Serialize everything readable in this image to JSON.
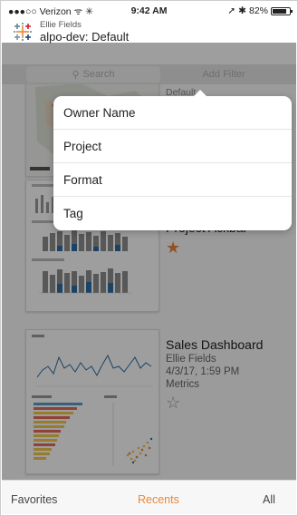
{
  "status_bar": {
    "carrier": "●●●○○ Verizon ᯤ ✳",
    "time": "9:42 AM",
    "location_glyph": "➚",
    "bluetooth_glyph": "✱",
    "battery": "82%"
  },
  "header": {
    "user": "Ellie Fields",
    "site": "alpo-dev: Default"
  },
  "search": {
    "placeholder_icon": "⚲",
    "placeholder": "Search",
    "filter_label": "Add Filter"
  },
  "list": {
    "partial_top_label": "Default",
    "items": [
      {
        "title": "Project Ackbar",
        "favorite": true,
        "star": "★"
      },
      {
        "title": "Sales Dashboard",
        "owner": "Ellie Fields",
        "modified": "4/3/17, 1:59 PM",
        "project": "Metrics",
        "favorite": false,
        "star": "☆"
      }
    ]
  },
  "filter_menu": {
    "options": [
      "Owner Name",
      "Project",
      "Format",
      "Tag"
    ]
  },
  "tabs": [
    {
      "label": "Favorites",
      "active": false
    },
    {
      "label": "Recents",
      "active": true
    },
    {
      "label": "All",
      "active": false
    }
  ],
  "colors": {
    "accent": "#e8873a",
    "overlay": "rgba(0,0,0,0.38)",
    "bar_gray": "#8f8f8f",
    "bar_blue": "#2b6ca3"
  },
  "icons": {
    "logo": "tableau-logo-icon",
    "search": "search-icon",
    "star_filled": "star-filled-icon",
    "star_empty": "star-outline-icon"
  }
}
